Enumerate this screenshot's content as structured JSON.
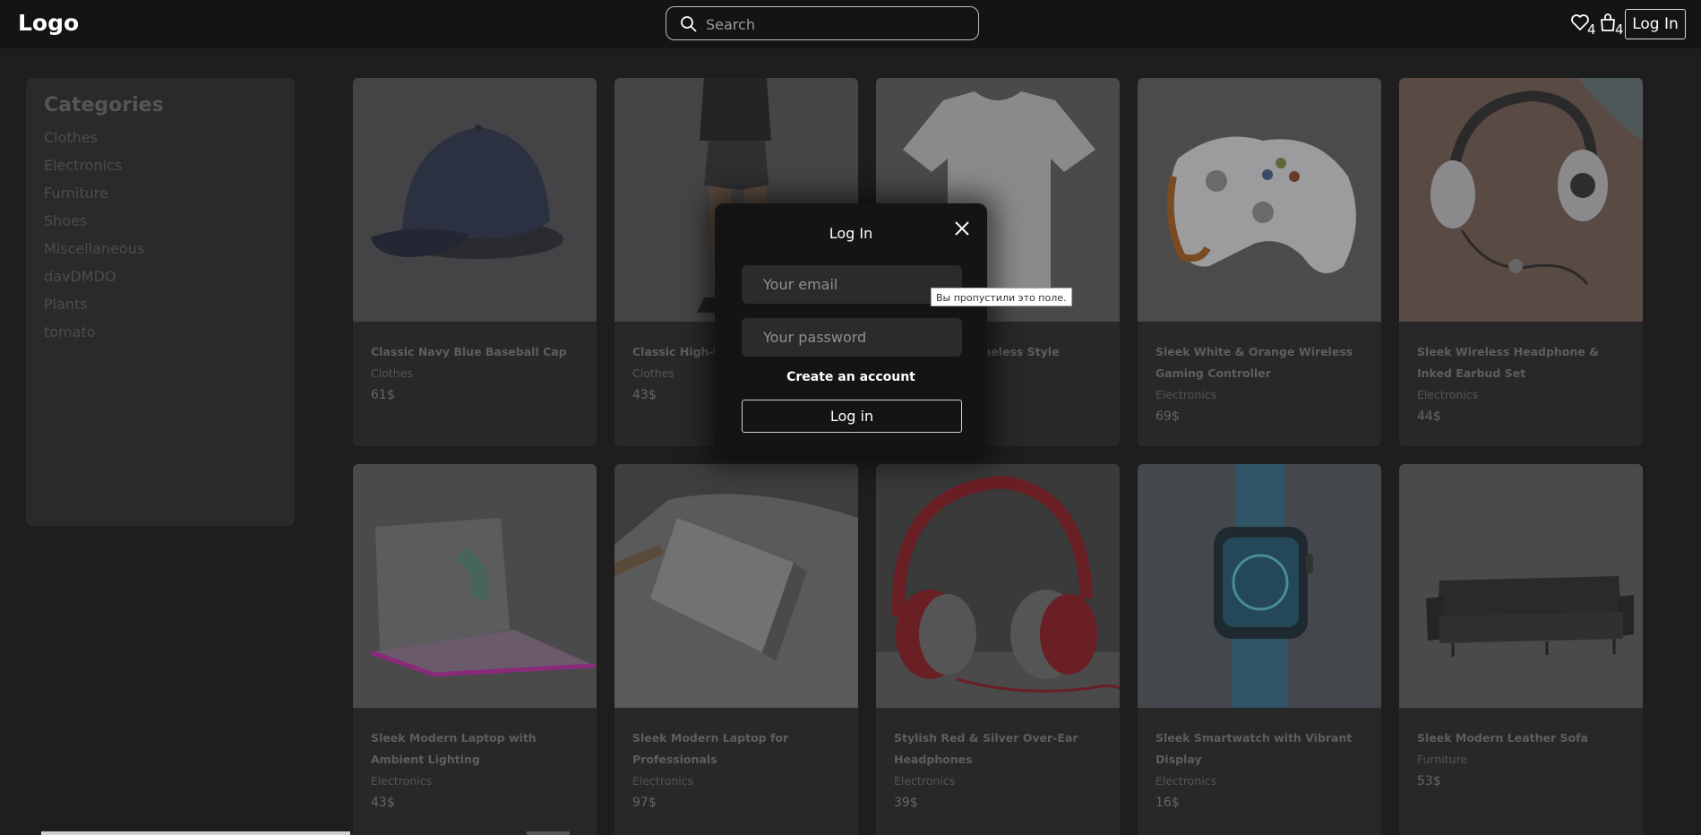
{
  "header": {
    "logo": "Logo",
    "search_placeholder": "Search",
    "favorites_count": "4",
    "cart_count": "4",
    "login_label": "Log In"
  },
  "sidebar": {
    "title": "Categories",
    "items": [
      "Clothes",
      "Electronics",
      "Furniture",
      "Shoes",
      "Miscellaneous",
      "davDMDO",
      "Plants",
      "tomato"
    ]
  },
  "products": [
    {
      "title": "Classic Navy Blue Baseball Cap",
      "category": "Clothes",
      "price": "61$",
      "image": "navy-cap"
    },
    {
      "title": "Classic High-W",
      "category": "Clothes",
      "price": "43$",
      "image": "woman-outfit"
    },
    {
      "title": "e - Timeless Style",
      "category": "",
      "price": "",
      "image": "white-tshirt"
    },
    {
      "title": "Sleek White & Orange Wireless Gaming Controller",
      "category": "Electronics",
      "price": "69$",
      "image": "game-controller"
    },
    {
      "title": "Sleek Wireless Headphone & Inked Earbud Set",
      "category": "Electronics",
      "price": "44$",
      "image": "headphones-earbuds"
    },
    {
      "title": "Sleek Modern Laptop with Ambient Lighting",
      "category": "Electronics",
      "price": "43$",
      "image": "laptop-ambient"
    },
    {
      "title": "Sleek Modern Laptop for Professionals",
      "category": "Electronics",
      "price": "97$",
      "image": "laptop-gray"
    },
    {
      "title": "Stylish Red & Silver Over-Ear Headphones",
      "category": "Electronics",
      "price": "39$",
      "image": "red-headphones"
    },
    {
      "title": "Sleek Smartwatch with Vibrant Display",
      "category": "Electronics",
      "price": "16$",
      "image": "smartwatch"
    },
    {
      "title": "Sleek Modern Leather Sofa",
      "category": "Furniture",
      "price": "53$",
      "image": "sofa"
    }
  ],
  "modal": {
    "title": "Log In",
    "email_placeholder": "Your email",
    "password_placeholder": "Your password",
    "create_account": "Create an account",
    "submit_label": "Log in"
  },
  "tooltip": "Вы пропустили это поле.",
  "colors": {
    "background": "#1e1e1f",
    "header": "#141414",
    "card": "#282829",
    "modal": "#141414"
  }
}
